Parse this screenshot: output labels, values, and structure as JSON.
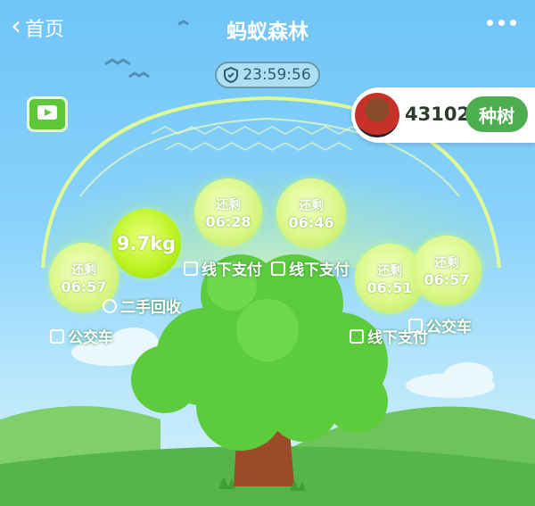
{
  "header": {
    "back_label": "首页",
    "title": "蚂蚁森林"
  },
  "timer": {
    "text": "23:59:56"
  },
  "user": {
    "energy": "43102g",
    "plant_button": "种树"
  },
  "bubbles": [
    {
      "label": "还剩",
      "time": "06:57"
    },
    {
      "label": "9.7kg"
    },
    {
      "label": "还剩",
      "time": "06:28"
    },
    {
      "label": "还剩",
      "time": "06:46"
    },
    {
      "label": "还剩",
      "time": "06:51"
    },
    {
      "label": "还剩",
      "time": "06:57"
    }
  ],
  "sources": [
    "线下支付",
    "线下支付",
    "二手回收",
    "公交车",
    "线下支付",
    "公交车"
  ],
  "colors": {
    "sky": "#8ad3fb",
    "accent_green": "#4cae4f",
    "energy": "#b9f21c"
  }
}
